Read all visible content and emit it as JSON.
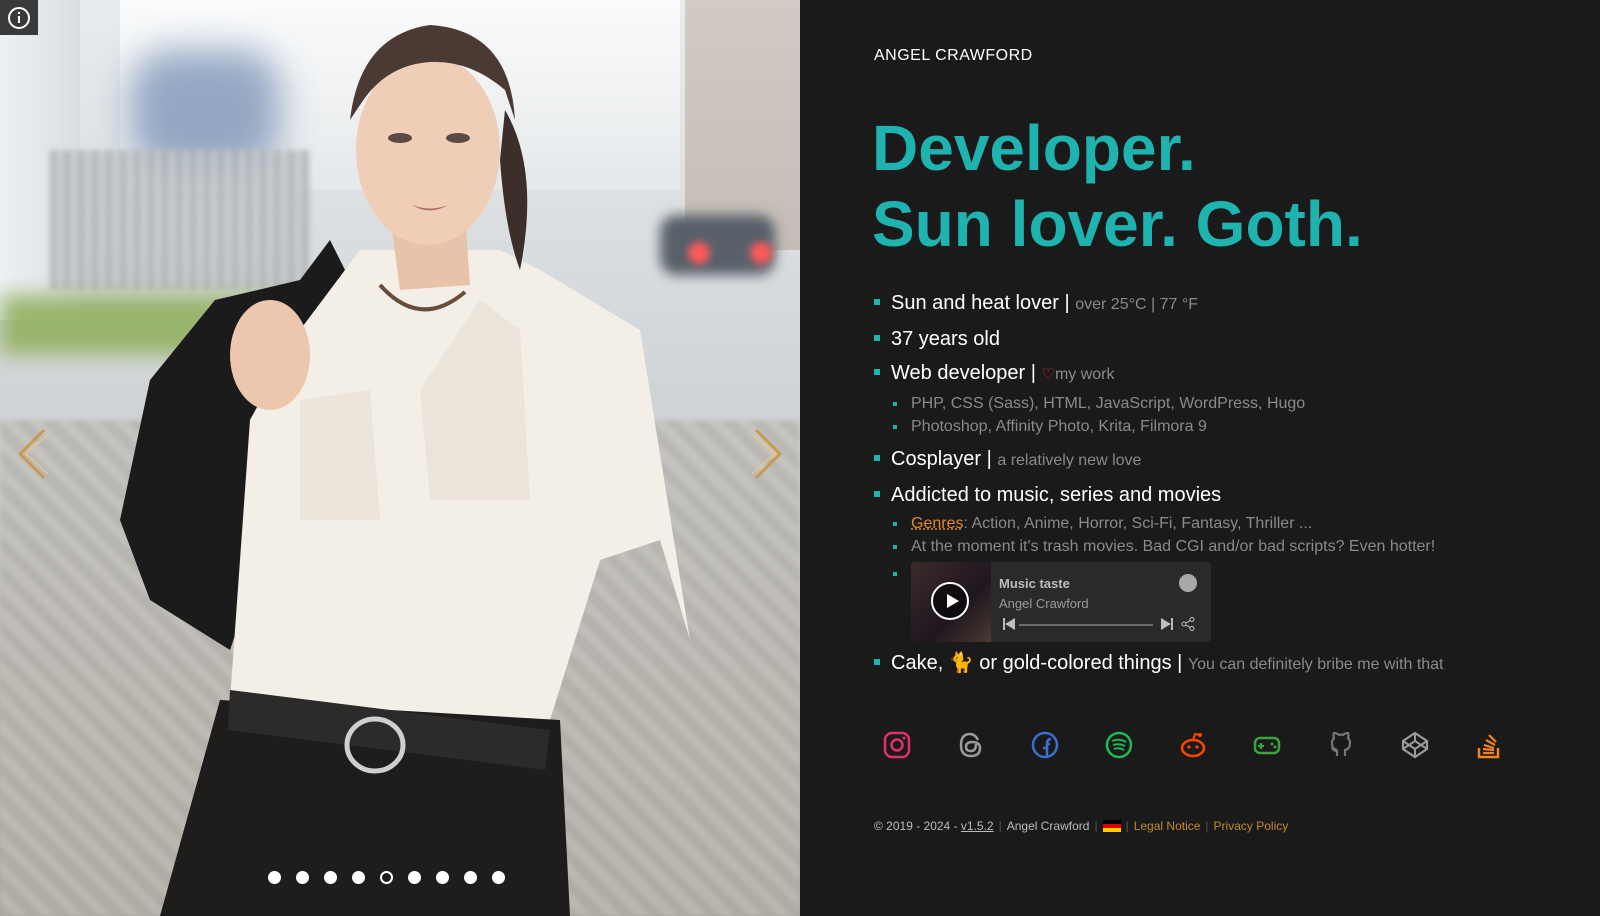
{
  "profile": {
    "name": "ANGEL CRAWFORD",
    "headline": [
      "Developer.",
      "Sun lover. Goth."
    ]
  },
  "facts": {
    "sun": {
      "main": "Sun and heat lover |",
      "note": "over 25°C | 77 °F"
    },
    "age": {
      "main": "37 years old"
    },
    "webdev": {
      "main": "Web developer |",
      "note": "my work",
      "heart_icon": "heart-icon",
      "skills": [
        "PHP, CSS (Sass), HTML, JavaScript, WordPress, Hugo",
        "Photoshop, Affinity Photo, Krita, Filmora 9"
      ]
    },
    "cosplay": {
      "main": "Cosplayer |",
      "note": "a relatively new love"
    },
    "music": {
      "main": "Addicted to music, series and movies",
      "genres_label": "Genres",
      "genres_list": ": Action, Anime, Horror, Sci-Fi, Fantasy, Thriller ...",
      "trash": "At the moment it's trash movies. Bad CGI and/or bad scripts? Even hotter!"
    },
    "cake": {
      "main_a": "Cake,",
      "emoji": "🐈",
      "main_b": "or gold-colored things |",
      "note": "You can definitely bribe me with that"
    }
  },
  "spotify_embed": {
    "title": "Music taste",
    "artist": "Angel Crawford"
  },
  "socials": [
    {
      "name": "instagram-icon",
      "color": "#e1306c"
    },
    {
      "name": "threads-icon",
      "color": "#9a9a9a"
    },
    {
      "name": "facebook-icon",
      "color": "#3b6fd1"
    },
    {
      "name": "spotify-icon",
      "color": "#1db954"
    },
    {
      "name": "reddit-icon",
      "color": "#ff4500"
    },
    {
      "name": "gaming-icon",
      "color": "#3aa63a"
    },
    {
      "name": "github-icon",
      "color": "#777777"
    },
    {
      "name": "codepen-icon",
      "color": "#9a9a9a"
    },
    {
      "name": "stackoverflow-icon",
      "color": "#f48024"
    }
  ],
  "footer": {
    "copyright": "© 2019 - 2024 -",
    "version": "v1.5.2",
    "author": "Angel Crawford",
    "legal": "Legal Notice",
    "privacy": "Privacy Policy"
  },
  "slider": {
    "slide_count": 9,
    "active_index": 4
  },
  "colors": {
    "accent": "#1fb3b0",
    "link": "#c2892a",
    "background": "#1a1a1a"
  }
}
